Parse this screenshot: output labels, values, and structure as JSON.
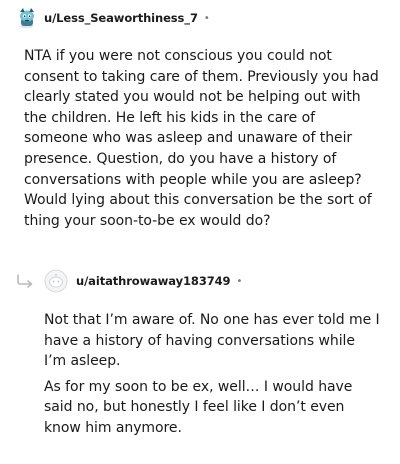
{
  "parent_comment": {
    "username": "u/Less_Seaworthiness_7",
    "separator": "•",
    "body": "NTA if you were not conscious you could not consent to taking care of them. Previously you had clearly stated you would not be helping out with the children. He left his kids in the care of someone who was asleep and unaware of their presence. Question, do you have a history of conversations with people while you are asleep? Would lying about this conversation be the sort of thing your soon-to-be ex would do?"
  },
  "reply_comment": {
    "username": "u/aitathrowaway183749",
    "separator": "•",
    "paragraphs": [
      "Not that I’m aware of. No one has ever told me I have a history of having conversations while I’m asleep.",
      "As for my soon to be ex, well… I would have said no, but honestly I feel like I don’t even know him anymore."
    ]
  },
  "icons": {
    "parent_avatar": "snoo-avatar-icon",
    "reply_avatar": "default-avatar-icon",
    "reply_indicator": "reply-arrow-icon"
  },
  "colors": {
    "text": "#1a1a1b",
    "meta": "#7c7c7c",
    "avatar_teal": "#5fb6c9",
    "reply_line": "#c8cbcd"
  }
}
